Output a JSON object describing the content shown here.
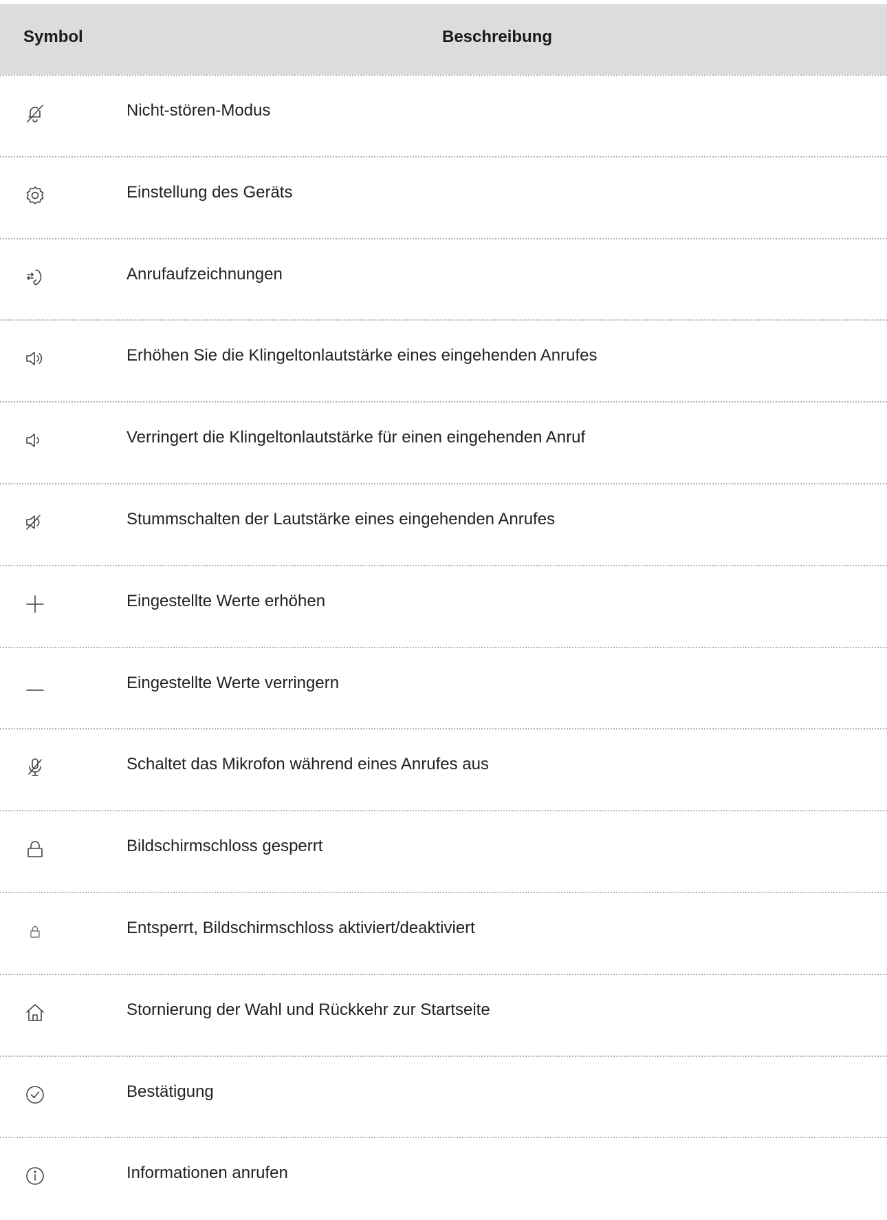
{
  "header": {
    "symbol": "Symbol",
    "description": "Beschreibung"
  },
  "rows": [
    {
      "icon": "bell-off-icon",
      "description": "Nicht-stören-Modus"
    },
    {
      "icon": "gear-icon",
      "description": "Einstellung des Geräts"
    },
    {
      "icon": "call-log-icon",
      "description": "Anrufaufzeichnungen"
    },
    {
      "icon": "volume-up-icon",
      "description": "Erhöhen Sie die Klingeltonlautstärke eines eingehenden Anrufes"
    },
    {
      "icon": "volume-down-icon",
      "description": "Verringert die Klingeltonlautstärke für einen eingehenden Anruf"
    },
    {
      "icon": "volume-mute-icon",
      "description": "Stummschalten der Lautstärke eines eingehenden Anrufes"
    },
    {
      "icon": "plus-icon",
      "description": "Eingestellte Werte erhöhen"
    },
    {
      "icon": "minus-icon",
      "description": "Eingestellte Werte verringern"
    },
    {
      "icon": "mic-off-icon",
      "description": "Schaltet das Mikrofon während eines Anrufes aus"
    },
    {
      "icon": "lock-icon",
      "description": "Bildschirmschloss gesperrt"
    },
    {
      "icon": "lock-small-icon",
      "description": "Entsperrt, Bildschirmschloss aktiviert/deaktiviert"
    },
    {
      "icon": "home-icon",
      "description": "Stornierung der Wahl und Rückkehr zur Startseite"
    },
    {
      "icon": "check-circle-icon",
      "description": "Bestätigung"
    },
    {
      "icon": "info-icon",
      "description": "Informationen anrufen"
    }
  ]
}
